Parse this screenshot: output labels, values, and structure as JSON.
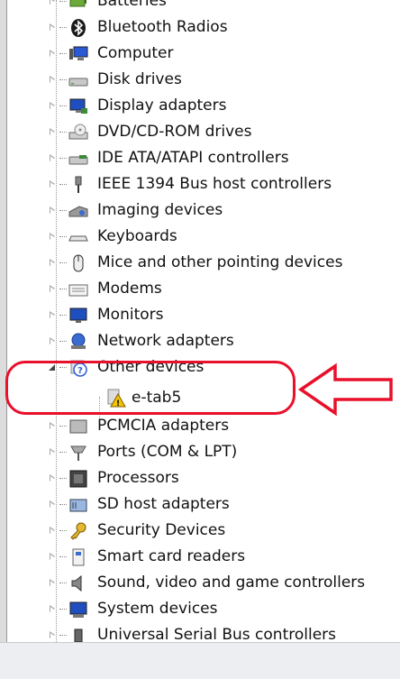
{
  "window": {
    "tree": {
      "items": [
        {
          "label": "Batteries",
          "icon": "battery-icon",
          "expanded": false
        },
        {
          "label": "Bluetooth Radios",
          "icon": "bluetooth-icon",
          "expanded": false
        },
        {
          "label": "Computer",
          "icon": "computer-icon",
          "expanded": false
        },
        {
          "label": "Disk drives",
          "icon": "disk-drive-icon",
          "expanded": false
        },
        {
          "label": "Display adapters",
          "icon": "display-adapter-icon",
          "expanded": false
        },
        {
          "label": "DVD/CD-ROM drives",
          "icon": "dvd-drive-icon",
          "expanded": false
        },
        {
          "label": "IDE ATA/ATAPI controllers",
          "icon": "ide-controller-icon",
          "expanded": false
        },
        {
          "label": "IEEE 1394 Bus host controllers",
          "icon": "firewire-icon",
          "expanded": false
        },
        {
          "label": "Imaging devices",
          "icon": "camera-icon",
          "expanded": false
        },
        {
          "label": "Keyboards",
          "icon": "keyboard-icon",
          "expanded": false
        },
        {
          "label": "Mice and other pointing devices",
          "icon": "mouse-icon",
          "expanded": false
        },
        {
          "label": "Modems",
          "icon": "modem-icon",
          "expanded": false
        },
        {
          "label": "Monitors",
          "icon": "monitor-icon",
          "expanded": false
        },
        {
          "label": "Network adapters",
          "icon": "network-adapter-icon",
          "expanded": false
        },
        {
          "label": "Other devices",
          "icon": "unknown-device-icon",
          "expanded": true,
          "children": [
            {
              "label": "e-tab5",
              "icon": "warning-device-icon"
            }
          ]
        },
        {
          "label": "PCMCIA adapters",
          "icon": "pcmcia-icon",
          "expanded": false
        },
        {
          "label": "Ports (COM & LPT)",
          "icon": "port-icon",
          "expanded": false
        },
        {
          "label": "Processors",
          "icon": "processor-icon",
          "expanded": false
        },
        {
          "label": "SD host adapters",
          "icon": "sd-card-icon",
          "expanded": false
        },
        {
          "label": "Security Devices",
          "icon": "key-icon",
          "expanded": false
        },
        {
          "label": "Smart card readers",
          "icon": "smart-card-icon",
          "expanded": false
        },
        {
          "label": "Sound, video and game controllers",
          "icon": "speaker-icon",
          "expanded": false
        },
        {
          "label": "System devices",
          "icon": "system-device-icon",
          "expanded": false
        },
        {
          "label": "Universal Serial Bus controllers",
          "icon": "usb-icon",
          "expanded": false
        }
      ]
    }
  },
  "annotation": {
    "highlight_color": "#e8102a",
    "arrow_icon": "left-arrow-icon"
  }
}
